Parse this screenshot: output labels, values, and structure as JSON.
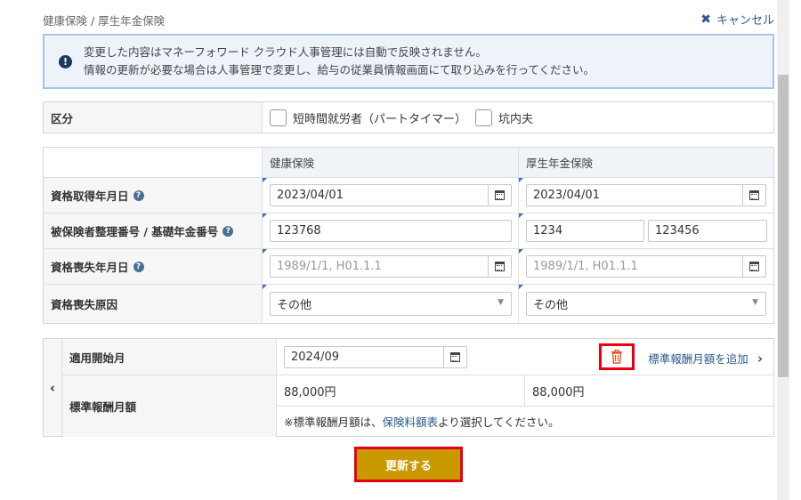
{
  "breadcrumb": "健康保険 / 厚生年金保険",
  "cancel_label": "キャンセル",
  "notice": {
    "line1": "変更した内容はマネーフォワード クラウド人事管理には自動で反映されません。",
    "line2": "情報の更新が必要な場合は人事管理で変更し、給与の従業員情報画面にて取り込みを行ってください。"
  },
  "category": {
    "label": "区分",
    "options": [
      "短時間就労者（パートタイマー）",
      "坑内夫"
    ]
  },
  "table": {
    "col_health": "健康保険",
    "col_pension": "厚生年金保険",
    "rows": {
      "acquire": {
        "label": "資格取得年月日",
        "health_value": "2023/04/01",
        "pension_value": "2023/04/01"
      },
      "number": {
        "label": "被保険者整理番号 / 基礎年金番号",
        "health_value": "123768",
        "pension_value_1": "1234",
        "pension_value_2": "123456"
      },
      "loss_date": {
        "label": "資格喪失年月日",
        "health_placeholder": "1989/1/1, H01.1.1",
        "pension_placeholder": "1989/1/1, H01.1.1"
      },
      "loss_reason": {
        "label": "資格喪失原因",
        "health_value": "その他",
        "pension_value": "その他"
      }
    }
  },
  "salary": {
    "start_label": "適用開始月",
    "start_value": "2024/09",
    "add_link": "標準報酬月額を追加",
    "monthly_label": "標準報酬月額",
    "health_amount": "88,000円",
    "pension_amount": "88,000円",
    "note_prefix": "※標準報酬月額は、",
    "note_link": "保険料額表",
    "note_suffix": "より選択してください。"
  },
  "submit_label": "更新する",
  "icons": {
    "info": "info-icon",
    "help": "question-icon",
    "calendar": "calendar-icon",
    "trash": "trash-icon",
    "close": "close-icon",
    "prev": "chevron-left-icon",
    "next": "chevron-right-icon"
  },
  "colors": {
    "accent": "#c89a00",
    "highlight": "#e60012",
    "link": "#2b5a8a"
  }
}
